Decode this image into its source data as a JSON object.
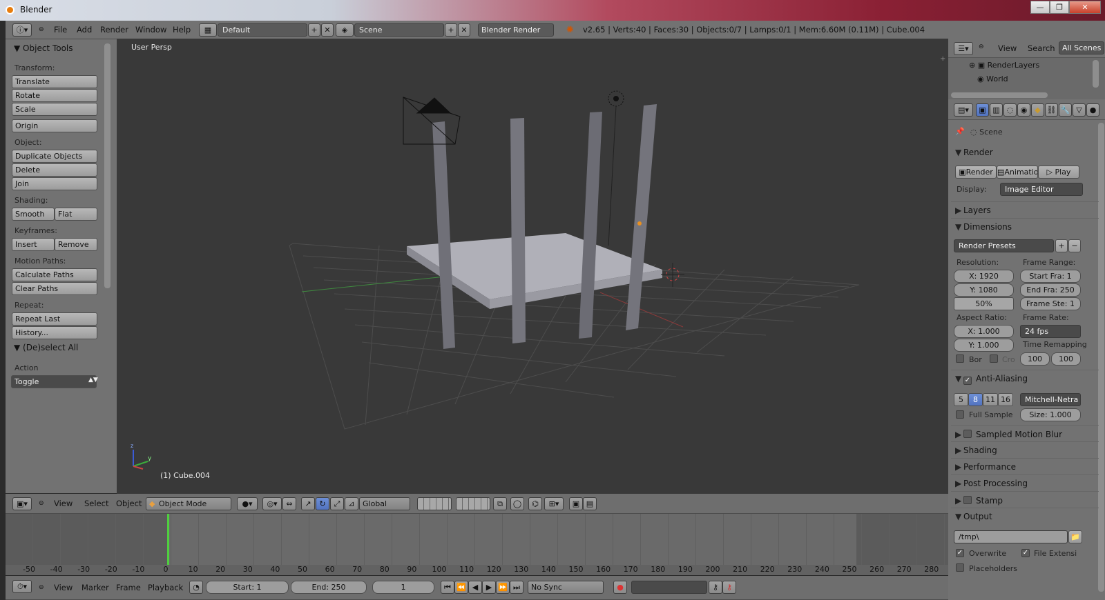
{
  "window": {
    "title": "Blender",
    "controls": [
      "—",
      "❐",
      "✕"
    ]
  },
  "top_header": {
    "menu": [
      "File",
      "Add",
      "Render",
      "Window",
      "Help"
    ],
    "layout_name": "Default",
    "scene_name": "Scene",
    "engine": "Blender Render",
    "stats": "v2.65 | Verts:40 | Faces:30 | Objects:0/7 | Lamps:0/1 | Mem:6.60M (0.11M) | Cube.004"
  },
  "tool_shelf": {
    "title": "Object Tools",
    "sections": {
      "transform": {
        "label": "Transform:",
        "buttons": [
          "Translate",
          "Rotate",
          "Scale"
        ]
      },
      "origin": "Origin",
      "object": {
        "label": "Object:",
        "buttons": [
          "Duplicate Objects",
          "Delete",
          "Join"
        ]
      },
      "shading": {
        "label": "Shading:",
        "buttons": [
          "Smooth",
          "Flat"
        ]
      },
      "keyframes": {
        "label": "Keyframes:",
        "buttons": [
          "Insert",
          "Remove"
        ]
      },
      "motion_paths": {
        "label": "Motion Paths:",
        "buttons": [
          "Calculate Paths",
          "Clear Paths"
        ]
      },
      "repeat": {
        "label": "Repeat:",
        "buttons": [
          "Repeat Last",
          "History..."
        ]
      }
    },
    "operator": {
      "title": "(De)select All",
      "label": "Action",
      "value": "Toggle"
    }
  },
  "viewport": {
    "view_label": "User Persp",
    "object_label": "(1) Cube.004",
    "header": {
      "menu": [
        "View",
        "Select",
        "Object"
      ],
      "mode": "Object Mode",
      "orientation": "Global"
    },
    "axis_y": "y",
    "axis_z": "z"
  },
  "timeline": {
    "ruler_ticks": [
      -50,
      -40,
      -30,
      -20,
      -10,
      0,
      10,
      20,
      30,
      40,
      50,
      60,
      70,
      80,
      90,
      100,
      110,
      120,
      130,
      140,
      150,
      160,
      170,
      180,
      190,
      200,
      210,
      220,
      230,
      240,
      250,
      260,
      270,
      280
    ],
    "current_frame_marker": 0,
    "header": {
      "menu": [
        "View",
        "Marker",
        "Frame",
        "Playback"
      ],
      "start": "Start: 1",
      "end": "End: 250",
      "current": "1",
      "sync": "No Sync"
    }
  },
  "outliner": {
    "menu": [
      "View",
      "Search"
    ],
    "filter": "All Scenes",
    "items": [
      "RenderLayers",
      "World"
    ]
  },
  "properties": {
    "context": "Scene",
    "render": {
      "title": "Render",
      "buttons": [
        "Render",
        "Animatio",
        "Play"
      ],
      "display_label": "Display:",
      "display_value": "Image Editor"
    },
    "layers": "Layers",
    "dimensions": {
      "title": "Dimensions",
      "presets": "Render Presets",
      "resolution_label": "Resolution:",
      "res_x": "X: 1920",
      "res_y": "Y: 1080",
      "res_pct": "50%",
      "frame_range_label": "Frame Range:",
      "start": "Start Fra: 1",
      "end": "End Fra: 250",
      "step": "Frame Ste: 1",
      "aspect_label": "Aspect Ratio:",
      "aspect_x": "X: 1.000",
      "aspect_y": "Y: 1.000",
      "frame_rate_label": "Frame Rate:",
      "fps": "24 fps",
      "remap_label": "Time Remapping",
      "remap_old": "100",
      "remap_new": "100",
      "border": "Bor",
      "crop": "Cro"
    },
    "anti_aliasing": {
      "title": "Anti-Aliasing",
      "samples": [
        "5",
        "8",
        "11",
        "16"
      ],
      "selected_sample": "8",
      "filter": "Mitchell-Netra",
      "full_sample": "Full Sample",
      "size": "Size: 1.000"
    },
    "collapsed": {
      "motion_blur": "Sampled Motion Blur",
      "shading": "Shading",
      "performance": "Performance",
      "post": "Post Processing",
      "stamp": "Stamp"
    },
    "output": {
      "title": "Output",
      "path": "/tmp\\",
      "overwrite": "Overwrite",
      "file_ext": "File Extensi",
      "placeholders": "Placeholders"
    }
  }
}
